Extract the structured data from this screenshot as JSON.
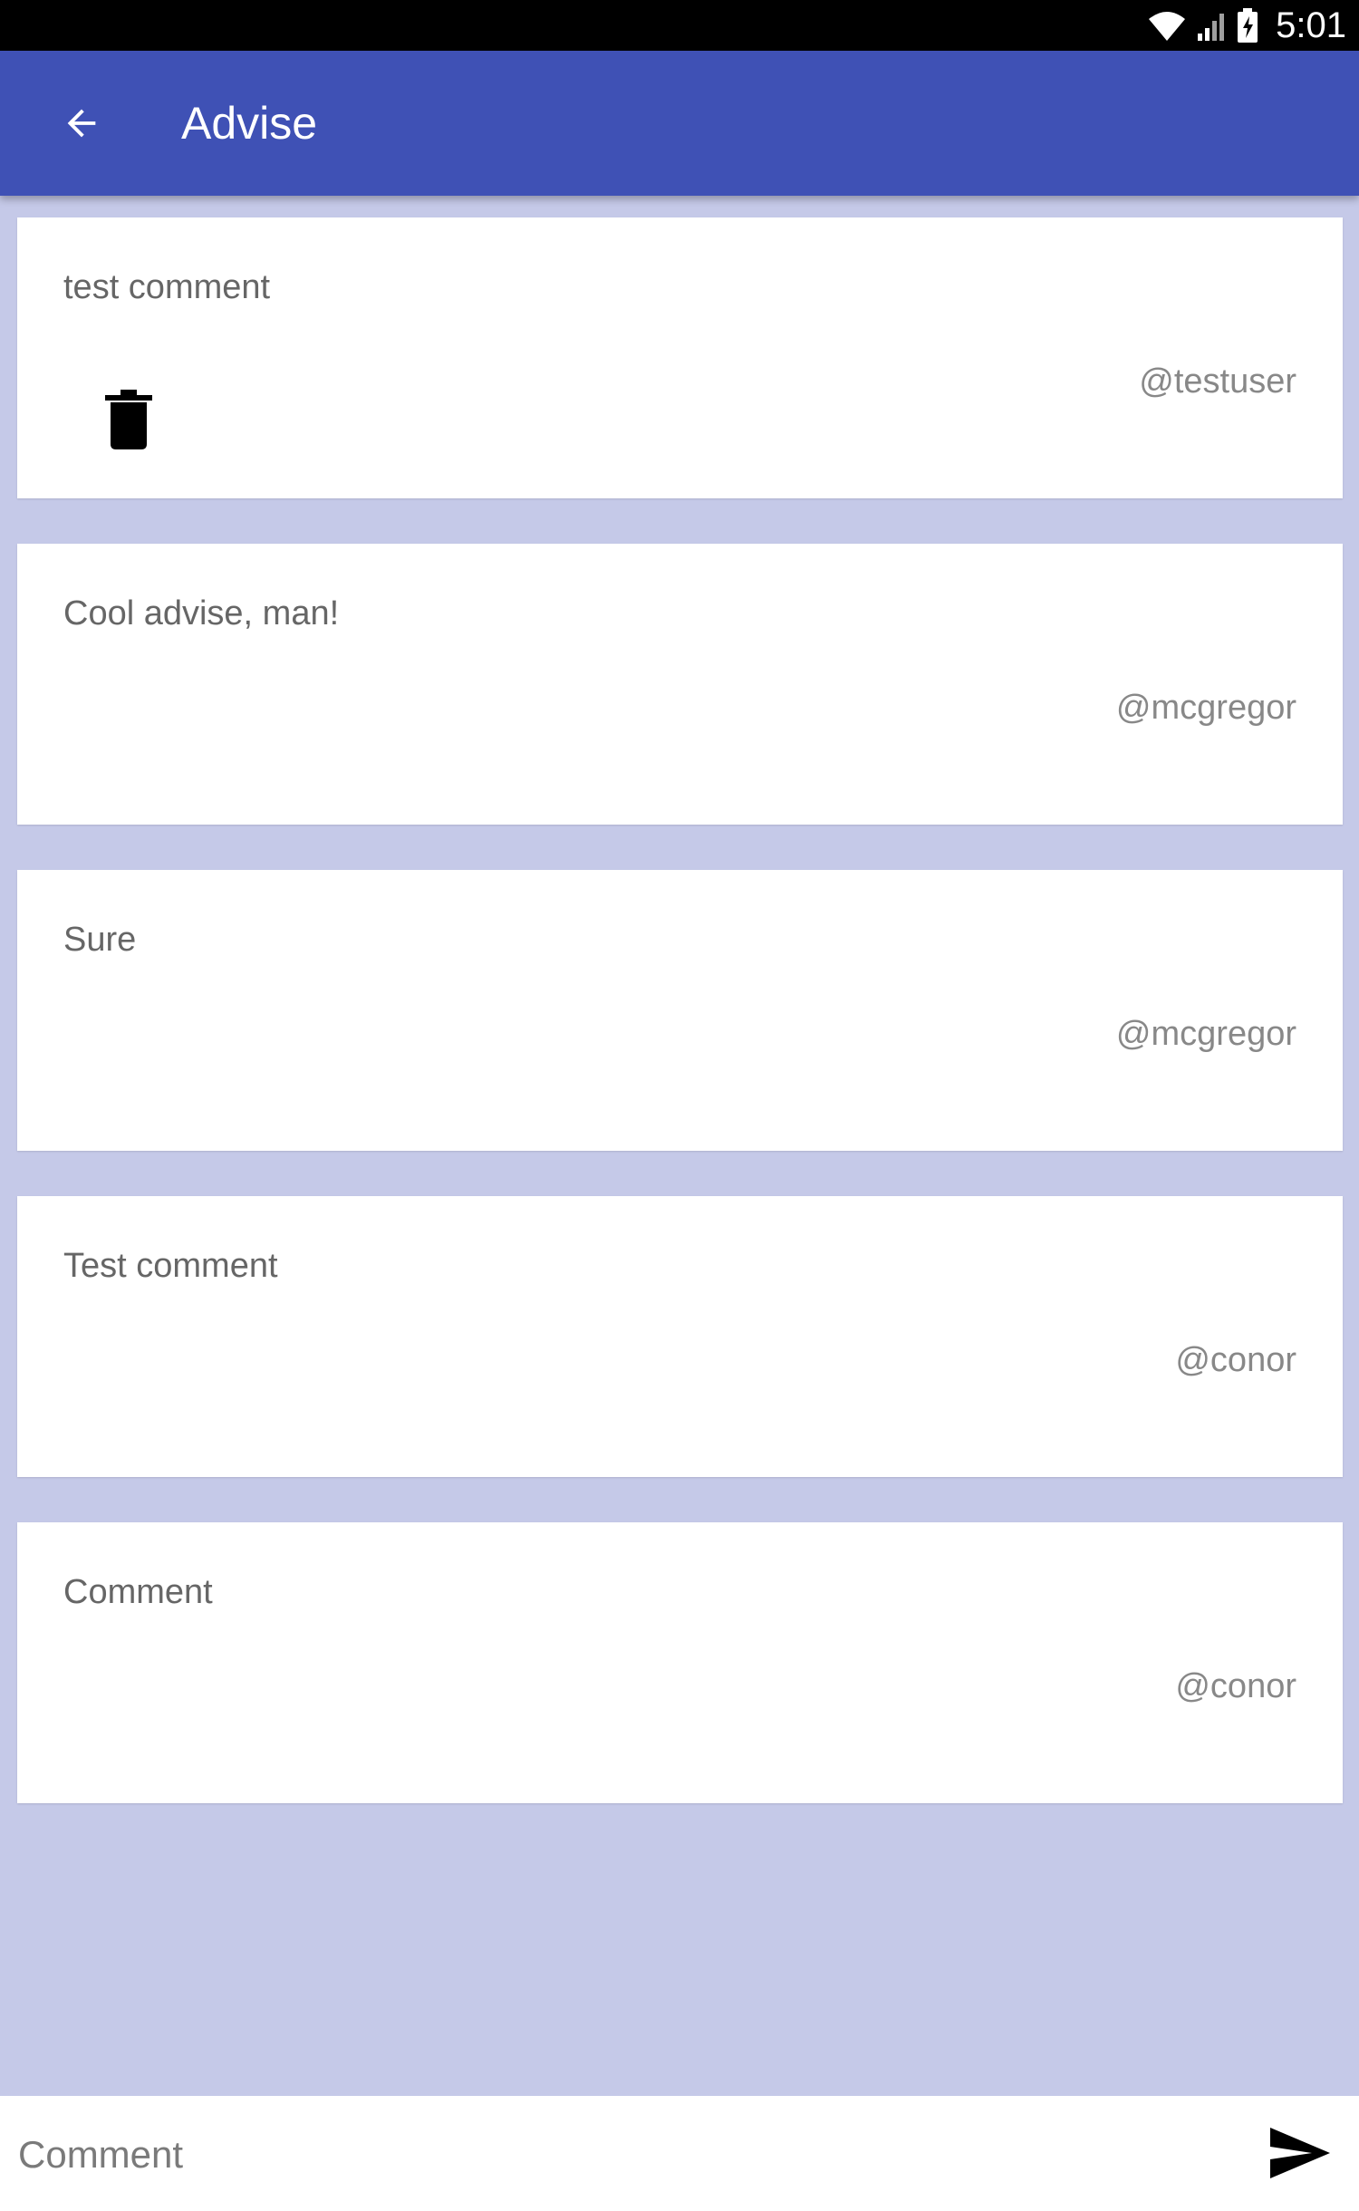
{
  "status_bar": {
    "time": "5:01",
    "icons": [
      "wifi-icon",
      "signal-icon",
      "battery-icon"
    ]
  },
  "app_bar": {
    "title": "Advise",
    "back_icon": "arrow-back-icon",
    "color": "#3f51b5"
  },
  "comments": [
    {
      "text": "test comment",
      "user": "@testuser",
      "deletable": true
    },
    {
      "text": "Cool advise, man!",
      "user": "@mcgregor",
      "deletable": false
    },
    {
      "text": "Sure",
      "user": "@mcgregor",
      "deletable": false
    },
    {
      "text": "Test comment",
      "user": "@conor",
      "deletable": false
    },
    {
      "text": "Comment",
      "user": "@conor",
      "deletable": false
    }
  ],
  "composer": {
    "placeholder": "Comment",
    "value": "",
    "send_icon": "send-icon"
  },
  "colors": {
    "background": "#c5c9e8",
    "card": "#ffffff",
    "primary": "#3f51b5"
  }
}
